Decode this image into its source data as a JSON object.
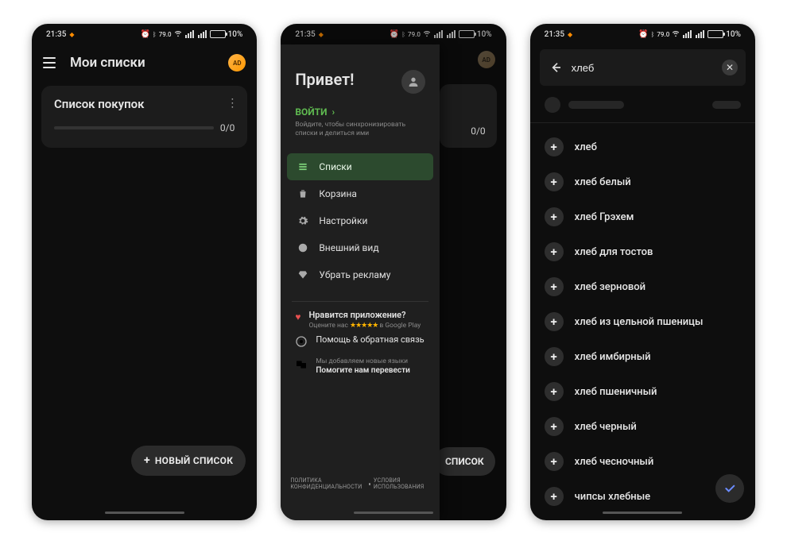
{
  "status": {
    "time": "21:35",
    "battery_pct": "10%",
    "speed": "79.0"
  },
  "screen1": {
    "title": "Мои списки",
    "ad_badge": "AD",
    "card_title": "Список покупок",
    "progress": "0/0",
    "fab": "НОВЫЙ СПИСОК"
  },
  "screen2": {
    "hello": "Привет!",
    "login": "ВОЙТИ",
    "login_sub": "Войдите, чтобы синхронизировать списки и делиться ими",
    "nav": {
      "lists": "Списки",
      "trash": "Корзина",
      "settings": "Настройки",
      "appearance": "Внешний вид",
      "remove_ads": "Убрать рекламу"
    },
    "rate_title": "Нравится приложение?",
    "rate_sub_pre": "Оцените нас",
    "rate_sub_post": "в Google Play",
    "help": "Помощь & обратная связь",
    "translate_sup": "Мы добавляем новые языки",
    "translate_title": "Помогите нам перевести",
    "footer_privacy": "ПОЛИТИКА КОНФИДЕНЦИАЛЬНОСТИ",
    "footer_terms": "УСЛОВИЯ ИСПОЛЬЗОВАНИЯ",
    "bg_progress": "0/0",
    "bg_fab": "СПИСОК",
    "ad_badge": "AD"
  },
  "screen3": {
    "query": "хлеб",
    "results": [
      "хлеб",
      "хлеб белый",
      "хлеб Грэхем",
      "хлеб для тостов",
      "хлеб зерновой",
      "хлеб из цельной пшеницы",
      "хлеб имбирный",
      "хлеб пшеничный",
      "хлеб черный",
      "хлеб чесночный",
      "чипсы хлебные"
    ]
  }
}
